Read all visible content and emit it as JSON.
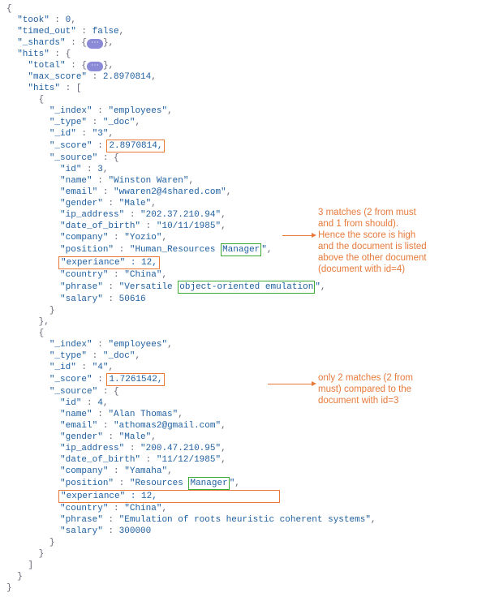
{
  "response": {
    "took": 0,
    "timed_out": "false",
    "shards_folded": "⋯",
    "hits": {
      "total_folded": "⋯",
      "max_score": "2.8970814",
      "hits_array": [
        {
          "_index": "employees",
          "_type": "_doc",
          "_id": "3",
          "_score": "2.8970814,",
          "source": {
            "id": 3,
            "name": "Winston Waren",
            "email": "wwaren2@4shared.com",
            "gender": "Male",
            "ip_address": "202.37.210.94",
            "date_of_birth": "10/11/1985",
            "company": "Yozio",
            "position_pre": "Human_Resources ",
            "position_hl": "Manager",
            "experience_line": "\"experiance\" : 12,",
            "country": "China",
            "phrase_pre": "Versatile ",
            "phrase_hl": "object-oriented emulation",
            "salary": 50616
          }
        },
        {
          "_index": "employees",
          "_type": "_doc",
          "_id": "4",
          "_score": "1.7261542,",
          "source": {
            "id": 4,
            "name": "Alan Thomas",
            "email": "athomas2@gmail.com",
            "gender": "Male",
            "ip_address": "200.47.210.95",
            "date_of_birth": "11/12/1985",
            "company": "Yamaha",
            "position_pre": "Resources ",
            "position_hl": "Manager",
            "experience_line": "\"experiance\" : 12,",
            "country": "China",
            "phrase": "Emulation of roots heuristic coherent systems",
            "salary": 300000
          }
        }
      ]
    }
  },
  "annotations": {
    "note1_l1": "3 matches (2 from must",
    "note1_l2": "and 1 from should).",
    "note1_l3": "Hence the score is high",
    "note1_l4": "and the document is listed",
    "note1_l5": "above the other document",
    "note1_l6": "(document with id=4)",
    "note2_l1": "only 2 matches (2 from",
    "note2_l2": "must) compared to the",
    "note2_l3": "document with id=3"
  },
  "labels": {
    "took": "\"took\"",
    "timed_out": "\"timed_out\"",
    "shards": "\"_shards\"",
    "hits": "\"hits\"",
    "total": "\"total\"",
    "max_score": "\"max_score\"",
    "index": "\"_index\"",
    "type": "\"_type\"",
    "id": "\"_id\"",
    "score": "\"_score\"",
    "source": "\"_source\"",
    "f_id": "\"id\"",
    "f_name": "\"name\"",
    "f_email": "\"email\"",
    "f_gender": "\"gender\"",
    "f_ip": "\"ip_address\"",
    "f_dob": "\"date_of_birth\"",
    "f_company": "\"company\"",
    "f_position": "\"position\"",
    "f_country": "\"country\"",
    "f_phrase": "\"phrase\"",
    "f_salary": "\"salary\""
  }
}
